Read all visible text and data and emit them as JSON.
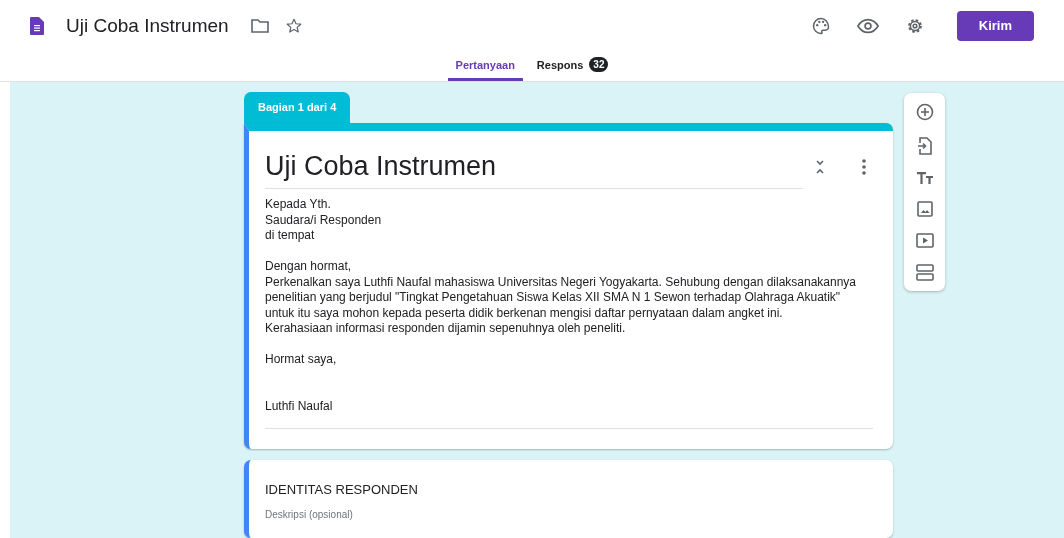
{
  "header": {
    "title": "Uji Coba Instrumen",
    "send_button": "Kirim"
  },
  "tabs": [
    {
      "label": "Pertanyaan",
      "selected": true
    },
    {
      "label": "Respons",
      "selected": false,
      "badge": "32"
    }
  ],
  "section_tab": "Bagian 1 dari 4",
  "form": {
    "title": "Uji Coba Instrumen",
    "description": "Kepada Yth.\nSaudara/i Responden\ndi tempat\n\nDengan hormat,\nPerkenalkan saya Luthfi Naufal mahasiswa Universitas Negeri Yogyakarta. Sehubung dengan dilaksanakannya\npenelitian yang berjudul \"Tingkat Pengetahuan Siswa Kelas XII SMA N 1 Sewon terhadap Olahraga Akuatik\"\nuntuk itu saya mohon kepada peserta didik berkenan mengisi daftar pernyataan dalam angket ini.\nKerahasiaan informasi responden dijamin sepenuhnya oleh peneliti.\n\nHormat saya,\n\n\nLuthfi Naufal"
  },
  "section": {
    "title": "IDENTITAS RESPONDEN",
    "placeholder": "Deskripsi (opsional)"
  },
  "toolbar": [
    {
      "kind": "add"
    },
    {
      "kind": "import"
    },
    {
      "kind": "text"
    },
    {
      "kind": "image"
    },
    {
      "kind": "video"
    },
    {
      "kind": "section"
    }
  ]
}
